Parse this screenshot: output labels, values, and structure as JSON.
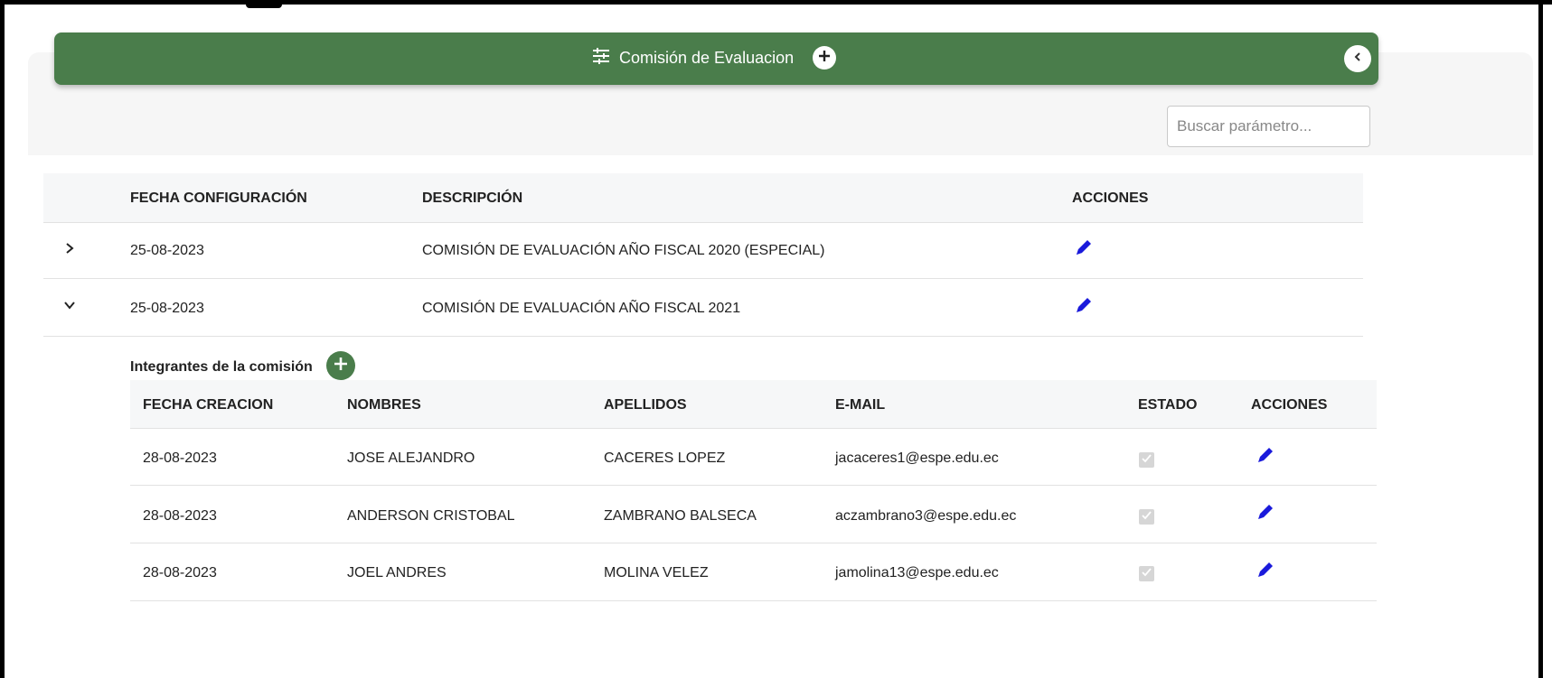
{
  "header": {
    "title": "Comisión de Evaluacion",
    "bg_color": "#4a7d4b"
  },
  "search": {
    "placeholder": "Buscar parámetro..."
  },
  "main_table": {
    "columns": [
      "FECHA CONFIGURACIÓN",
      "DESCRIPCIÓN",
      "ACCIONES"
    ],
    "rows": [
      {
        "expanded": false,
        "fecha": "25-08-2023",
        "descripcion": "COMISIÓN DE EVALUACIÓN AÑO FISCAL 2020 (ESPECIAL)"
      },
      {
        "expanded": true,
        "fecha": "25-08-2023",
        "descripcion": "COMISIÓN DE EVALUACIÓN AÑO FISCAL 2021"
      }
    ]
  },
  "members": {
    "title": "Integrantes de la comisión",
    "columns": [
      "FECHA CREACION",
      "NOMBRES",
      "APELLIDOS",
      "E-MAIL",
      "ESTADO",
      "ACCIONES"
    ],
    "rows": [
      {
        "fecha": "28-08-2023",
        "nombres": "JOSE ALEJANDRO",
        "apellidos": "CACERES LOPEZ",
        "email": "jacaceres1@espe.edu.ec",
        "estado": true
      },
      {
        "fecha": "28-08-2023",
        "nombres": "ANDERSON CRISTOBAL",
        "apellidos": "ZAMBRANO BALSECA",
        "email": "aczambrano3@espe.edu.ec",
        "estado": true
      },
      {
        "fecha": "28-08-2023",
        "nombres": "JOEL ANDRES",
        "apellidos": "MOLINA VELEZ",
        "email": "jamolina13@espe.edu.ec",
        "estado": true
      }
    ]
  },
  "icons": {
    "edit": "pencil-icon",
    "expand": "chevron-right-icon",
    "collapse": "chevron-down-icon",
    "add": "plus-icon",
    "back": "chevron-left-icon",
    "settings": "tune-icon"
  },
  "colors": {
    "accent_green": "#4a7d4b",
    "edit_blue": "#1a1adb"
  }
}
